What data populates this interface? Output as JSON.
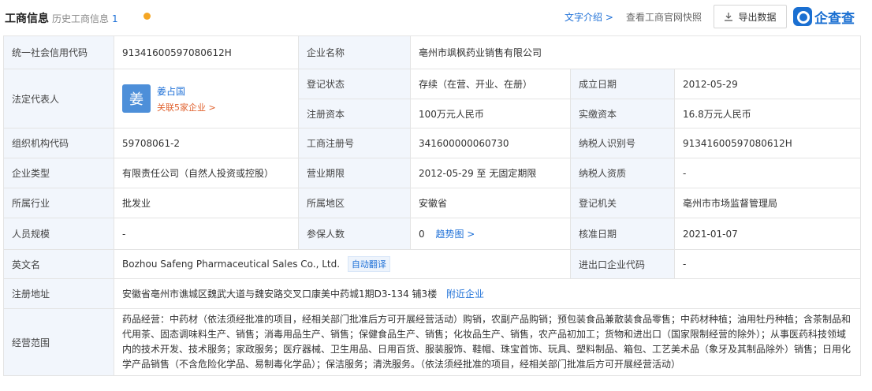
{
  "header": {
    "title": "工商信息",
    "history_label": "历史工商信息",
    "history_count": "1",
    "intro_link": "文字介绍 >",
    "official_link": "查看工商官网快照",
    "export_label": "导出数据",
    "brand": "企查查",
    "colors": {
      "accent": "#1e70d7",
      "dot": "#f5a623",
      "label_bg": "#f2f6fc"
    }
  },
  "info": {
    "credit_code_label": "统一社会信用代码",
    "credit_code": "91341600597080612H",
    "company_name_label": "企业名称",
    "company_name": "亳州市飒枫药业销售有限公司",
    "legal_rep_label": "法定代表人",
    "legal_rep_avatar": "姜",
    "legal_rep_name": "姜占国",
    "legal_rep_related": "关联5家企业 >",
    "status_label": "登记状态",
    "status": "存续（在营、开业、在册）",
    "founded_label": "成立日期",
    "founded": "2012-05-29",
    "reg_capital_label": "注册资本",
    "reg_capital": "100万元人民币",
    "paid_capital_label": "实缴资本",
    "paid_capital": "16.8万元人民币",
    "org_code_label": "组织机构代码",
    "org_code": "59708061-2",
    "reg_no_label": "工商注册号",
    "reg_no": "341600000060730",
    "taxpayer_id_label": "纳税人识别号",
    "taxpayer_id": "91341600597080612H",
    "company_type_label": "企业类型",
    "company_type": "有限责任公司（自然人投资或控股）",
    "term_label": "营业期限",
    "term": "2012-05-29 至 无固定期限",
    "taxpayer_qual_label": "纳税人资质",
    "taxpayer_qual": "-",
    "industry_label": "所属行业",
    "industry": "批发业",
    "region_label": "所属地区",
    "region": "安徽省",
    "authority_label": "登记机关",
    "authority": "亳州市市场监督管理局",
    "staff_size_label": "人员规模",
    "staff_size": "-",
    "insured_label": "参保人数",
    "insured": "0",
    "insured_trend": "趋势图 >",
    "approval_date_label": "核准日期",
    "approval_date": "2021-01-07",
    "english_name_label": "英文名",
    "english_name": "Bozhou Safeng Pharmaceutical Sales Co., Ltd.",
    "english_name_tag": "自动翻译",
    "import_export_label": "进出口企业代码",
    "import_export": "-",
    "address_label": "注册地址",
    "address": "安徽省亳州市谯城区魏武大道与魏安路交叉口康美中药城1期D3-134 铺3楼",
    "nearby_link": "附近企业",
    "scope_label": "经营范围",
    "scope": "药品经营：中药材（依法须经批准的项目，经相关部门批准后方可开展经营活动）购销，农副产品购销；预包装食品兼散装食品零售；中药材种植；油用牡丹种植；含茶制品和代用茶、固态调味料生产、销售；消毒用品生产、销售；保健食品生产、销售；化妆品生产、销售，农产品初加工；货物和进出口（国家限制经营的除外）；从事医药科技领域内的技术开发、技术服务；家政服务；医疗器械、卫生用品、日用百货、服装服饰、鞋帽、珠宝首饰、玩具、塑料制品、箱包、工艺美术品（象牙及其制品除外）销售；日用化学产品销售（不含危险化学品、易制毒化学品）；保洁服务；清洗服务。（依法须经批准的项目，经相关部门批准后方可开展经营活动）"
  }
}
